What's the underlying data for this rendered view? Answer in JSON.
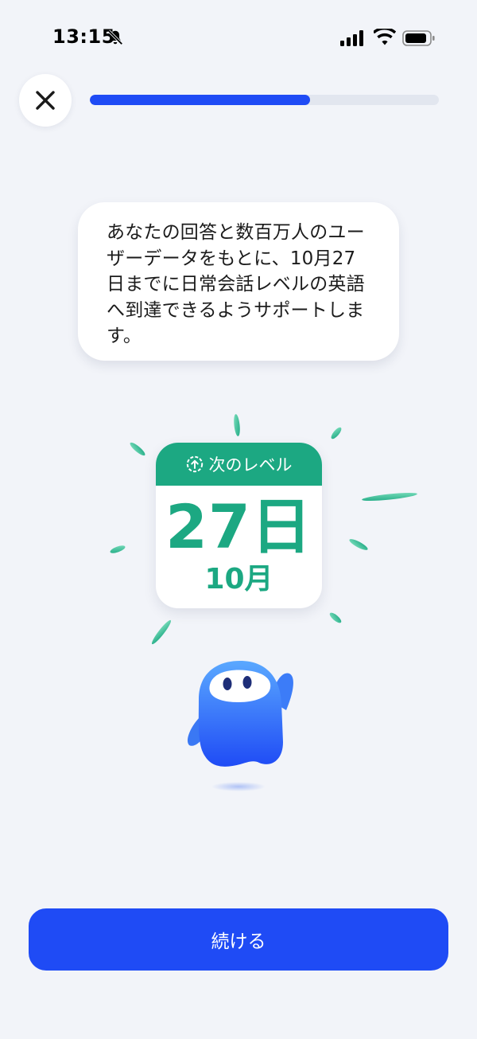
{
  "status_bar": {
    "time": "13:15"
  },
  "progress": {
    "fraction": 0.63,
    "fill_color": "#1F4BF5",
    "track_color": "#E2E6EF"
  },
  "message": {
    "lines": [
      "あなたの回答と数百万人のユー",
      "ザーデータをもとに、10月27",
      "日までに日常会話レベルの英語",
      "へ到達できるようサポートしま",
      "す。"
    ]
  },
  "calendar": {
    "header_label": "次のレベル",
    "day": "27日",
    "month": "10月",
    "accent_color": "#1CA882"
  },
  "actions": {
    "continue_label": "続ける"
  },
  "icons": {
    "close": "close-icon",
    "level_up": "arrow-up-circle-icon",
    "mascot": "mascot-character"
  }
}
